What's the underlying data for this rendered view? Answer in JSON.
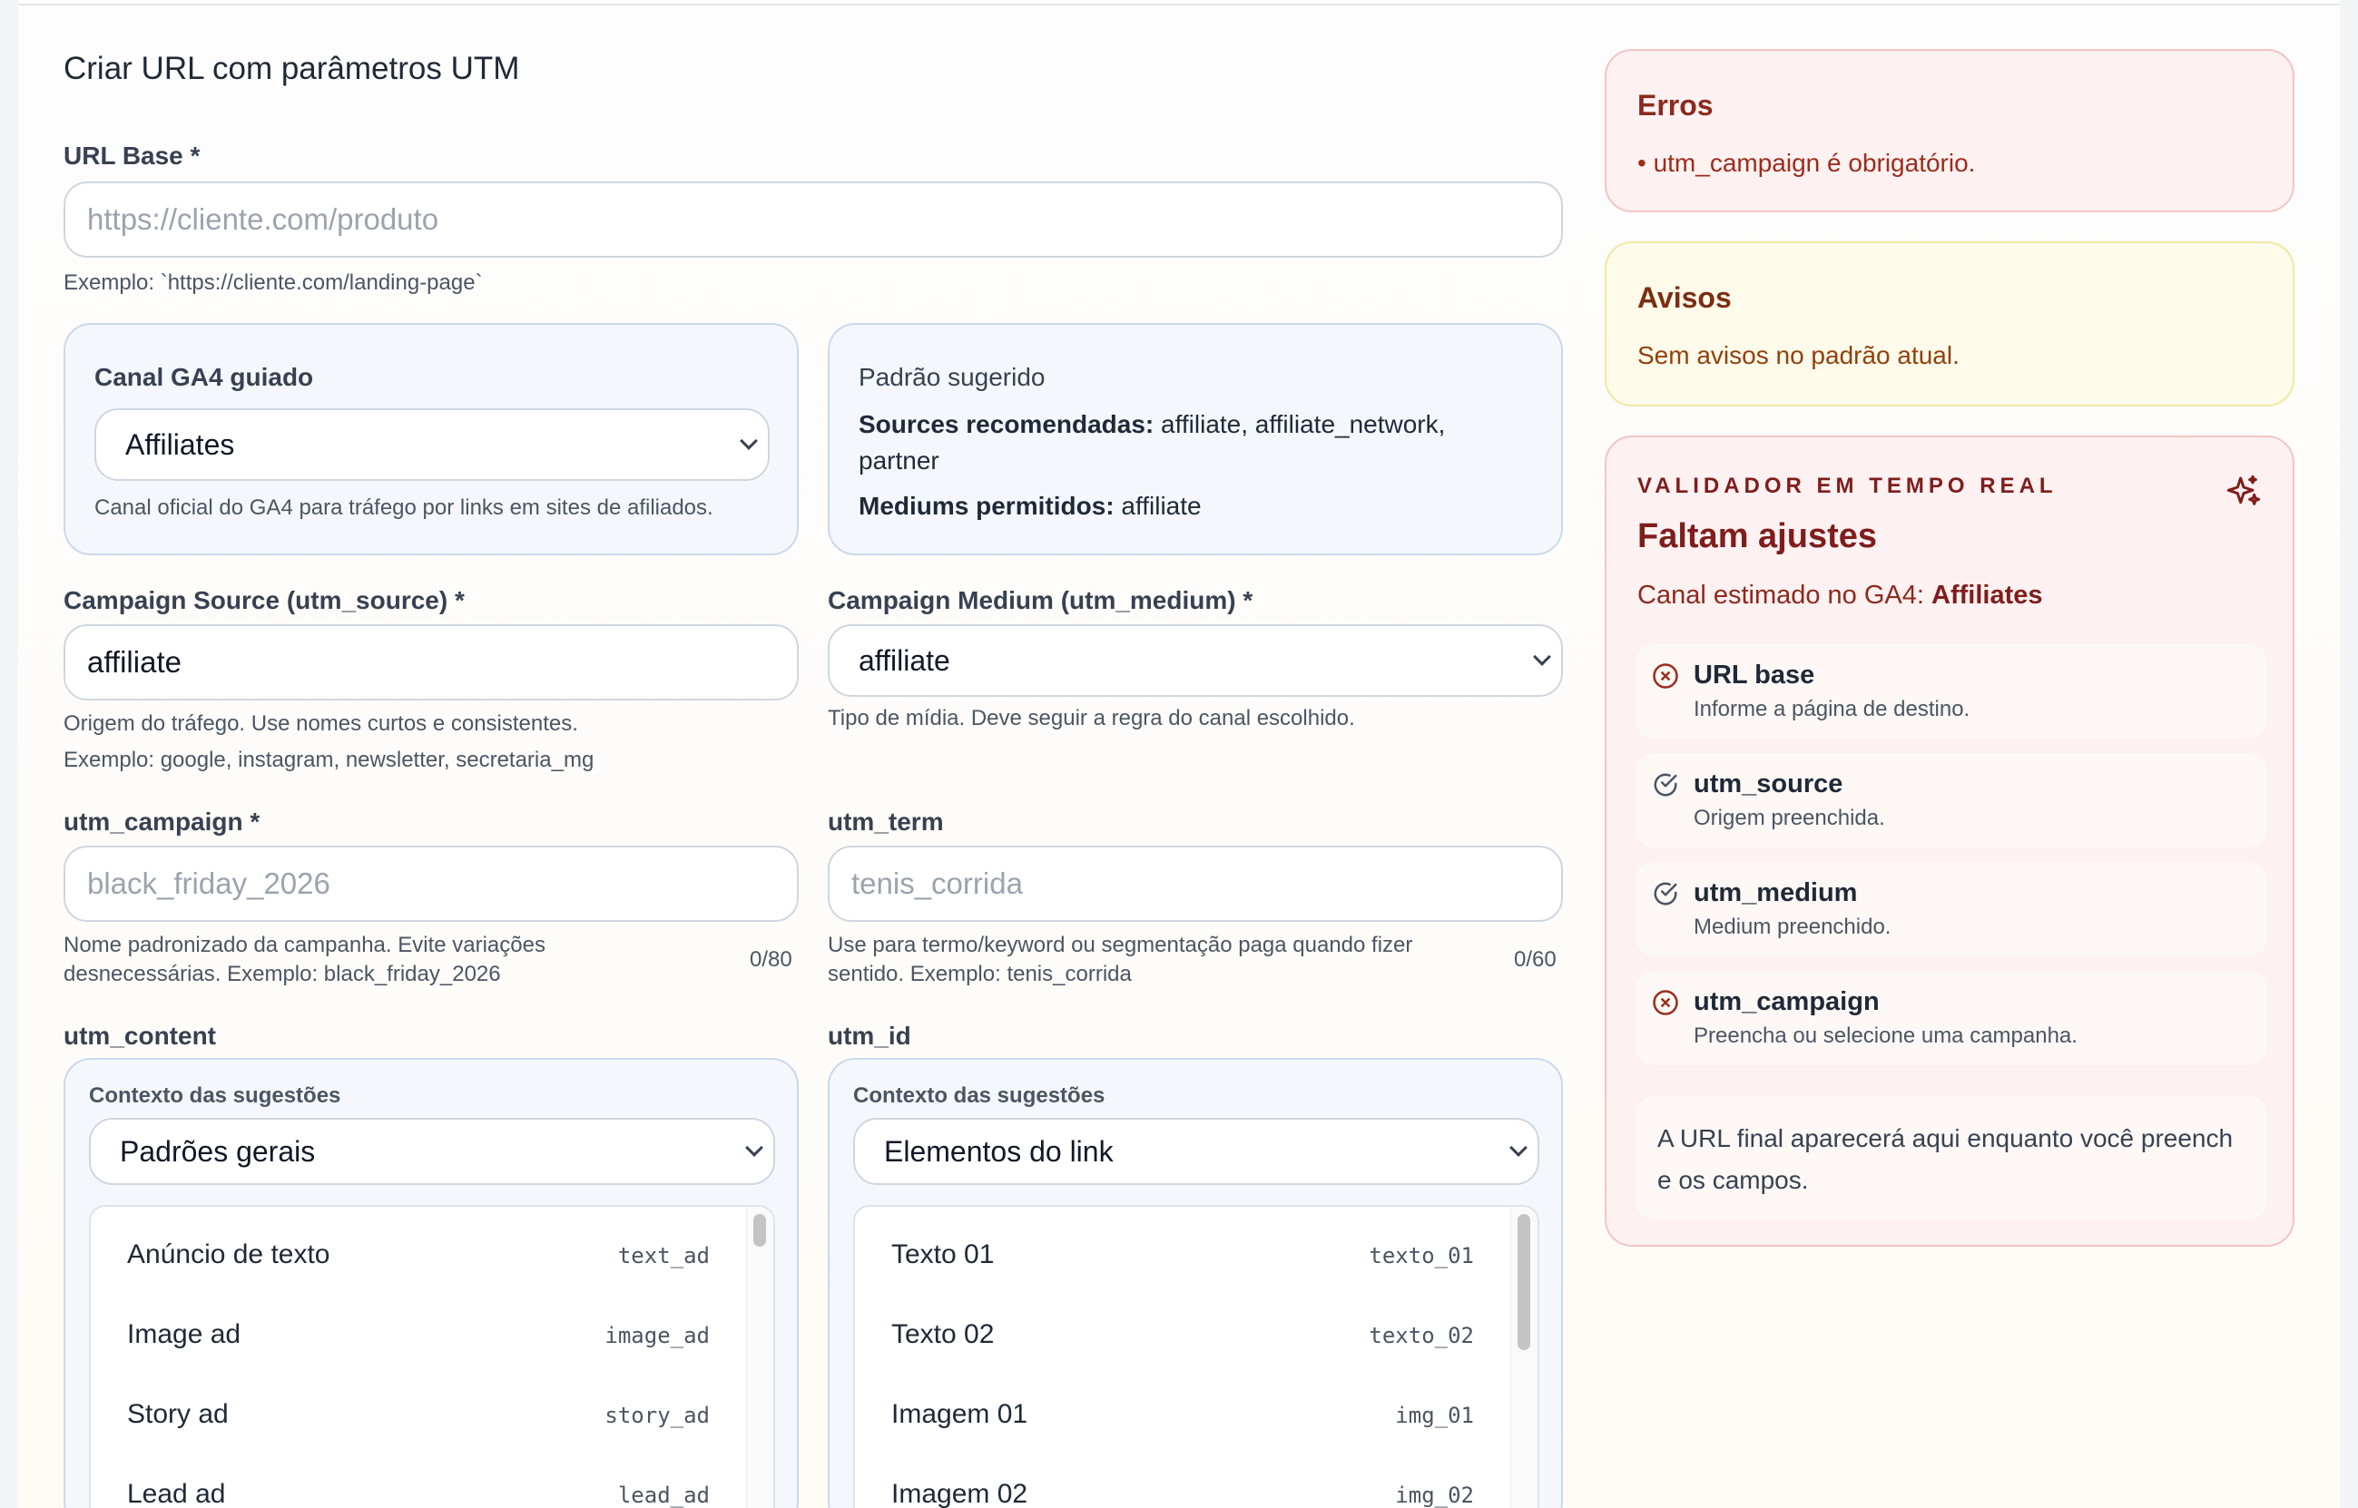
{
  "page": {
    "title": "Criar URL com parâmetros UTM"
  },
  "url_base": {
    "label": "URL Base *",
    "placeholder": "https://cliente.com/produto",
    "help": "Exemplo: `https://cliente.com/landing-page`"
  },
  "channel_card": {
    "title": "Canal GA4 guiado",
    "selected": "Affiliates",
    "help": "Canal oficial do GA4 para tráfego por links em sites de afiliados."
  },
  "pattern_card": {
    "title": "Padrão sugerido",
    "sources_label": "Sources recomendadas:",
    "sources_value": "affiliate, affiliate_network, partner",
    "mediums_label": "Mediums permitidos:",
    "mediums_value": "affiliate"
  },
  "utm_source": {
    "label": "Campaign Source (utm_source) *",
    "value": "affiliate",
    "help_line1": "Origem do tráfego. Use nomes curtos e consistentes.",
    "help_line2": "Exemplo: google, instagram, newsletter, secretaria_mg"
  },
  "utm_medium": {
    "label": "Campaign Medium (utm_medium) *",
    "selected": "affiliate",
    "help": "Tipo de mídia. Deve seguir a regra do canal escolhido."
  },
  "utm_campaign": {
    "label": "utm_campaign *",
    "placeholder": "black_friday_2026",
    "help": "Nome padronizado da campanha. Evite variações desnecessárias. Exemplo: black_friday_2026",
    "counter": "0/80"
  },
  "utm_term": {
    "label": "utm_term",
    "placeholder": "tenis_corrida",
    "help": "Use para termo/keyword ou segmentação paga quando fizer sentido. Exemplo: tenis_corrida",
    "counter": "0/60"
  },
  "utm_content": {
    "label": "utm_content",
    "context_label": "Contexto das sugestões",
    "context_selected": "Padrões gerais",
    "items": [
      {
        "label": "Anúncio de texto",
        "code": "text_ad"
      },
      {
        "label": "Image ad",
        "code": "image_ad"
      },
      {
        "label": "Story ad",
        "code": "story_ad"
      },
      {
        "label": "Lead ad",
        "code": "lead_ad"
      }
    ]
  },
  "utm_id": {
    "label": "utm_id",
    "context_label": "Contexto das sugestões",
    "context_selected": "Elementos do link",
    "items": [
      {
        "label": "Texto 01",
        "code": "texto_01"
      },
      {
        "label": "Texto 02",
        "code": "texto_02"
      },
      {
        "label": "Imagem 01",
        "code": "img_01"
      },
      {
        "label": "Imagem 02",
        "code": "img_02"
      }
    ]
  },
  "errors": {
    "title": "Erros",
    "items": [
      "• utm_campaign é obrigatório."
    ]
  },
  "warnings": {
    "title": "Avisos",
    "text": "Sem avisos no padrão atual."
  },
  "validator": {
    "kicker": "VALIDADOR EM TEMPO REAL",
    "heading": "Faltam ajustes",
    "channel_prefix": "Canal estimado no GA4:",
    "channel_value": "Affiliates",
    "checks": [
      {
        "title": "URL base",
        "sub": "Informe a página de destino.",
        "status": "error"
      },
      {
        "title": "utm_source",
        "sub": "Origem preenchida.",
        "status": "ok"
      },
      {
        "title": "utm_medium",
        "sub": "Medium preenchido.",
        "status": "ok"
      },
      {
        "title": "utm_campaign",
        "sub": "Preencha ou selecione uma campanha.",
        "status": "error"
      }
    ],
    "final_url_placeholder": "A URL final aparecerá aqui enquanto você preenche os campos."
  },
  "colors": {
    "error": "#9b2c1c",
    "ok": "#4b5563",
    "card_border": "#c9d9ec"
  }
}
